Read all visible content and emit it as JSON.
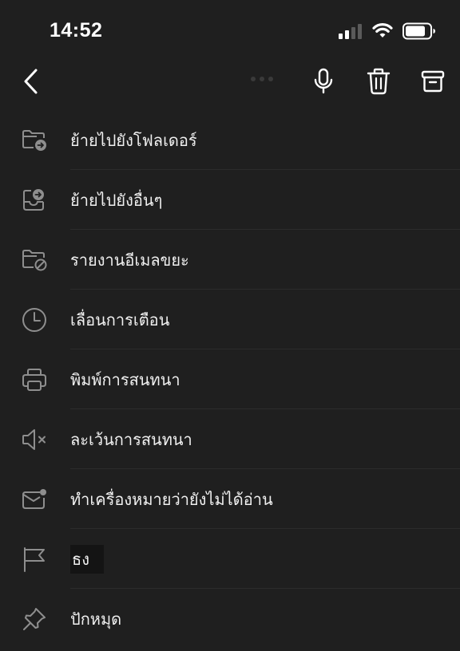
{
  "status_bar": {
    "time": "14:52",
    "icons": [
      "cellular-signal-icon",
      "wifi-icon",
      "battery-icon"
    ]
  },
  "toolbar": {
    "icons": [
      "back-chevron-icon",
      "more-dots-icon",
      "microphone-icon",
      "trash-icon",
      "archive-icon"
    ]
  },
  "menu": {
    "items": [
      {
        "label": "ย้ายไปยังโฟลเดอร์",
        "icon": "folder-move-icon"
      },
      {
        "label": "ย้ายไปยังอื่นๆ",
        "icon": "inbox-move-icon"
      },
      {
        "label": "รายงานอีเมลขยะ",
        "icon": "folder-block-icon"
      },
      {
        "label": "เลื่อนการเตือน",
        "icon": "clock-icon"
      },
      {
        "label": "พิมพ์การสนทนา",
        "icon": "printer-icon"
      },
      {
        "label": "ละเว้นการสนทนา",
        "icon": "speaker-mute-icon"
      },
      {
        "label": "ทำเครื่องหมายว่ายังไม่ได้อ่าน",
        "icon": "mail-unread-icon"
      },
      {
        "label": "ธง",
        "icon": "flag-icon"
      },
      {
        "label": "ปักหมุด",
        "icon": "pin-icon"
      }
    ]
  },
  "colors": {
    "background": "#1f1f1f",
    "icon": "#8e8e8e",
    "text": "#f0f0f0",
    "divider": "#2c2c2c"
  }
}
